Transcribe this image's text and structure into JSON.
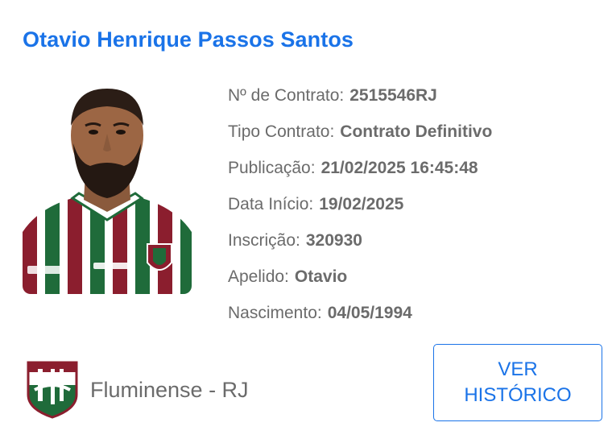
{
  "player": {
    "name": "Otavio Henrique Passos Santos"
  },
  "details": [
    {
      "label": "Nº de Contrato:",
      "value": "2515546RJ"
    },
    {
      "label": "Tipo Contrato:",
      "value": "Contrato Definitivo"
    },
    {
      "label": "Publicação:",
      "value": "21/02/2025 16:45:48"
    },
    {
      "label": "Data Início:",
      "value": "19/02/2025"
    },
    {
      "label": "Inscrição:",
      "value": "320930"
    },
    {
      "label": "Apelido:",
      "value": "Otavio"
    },
    {
      "label": "Nascimento:",
      "value": "04/05/1994"
    }
  ],
  "club": {
    "name": "Fluminense - RJ",
    "crest_icon": "fluminense-crest-icon"
  },
  "history_button": {
    "line1": "VER",
    "line2": "HISTÓRICO"
  },
  "colors": {
    "accent": "#1a73e8",
    "text": "#6b6b6b",
    "club_grena": "#8b1e2e",
    "club_green": "#1f6b3a"
  }
}
